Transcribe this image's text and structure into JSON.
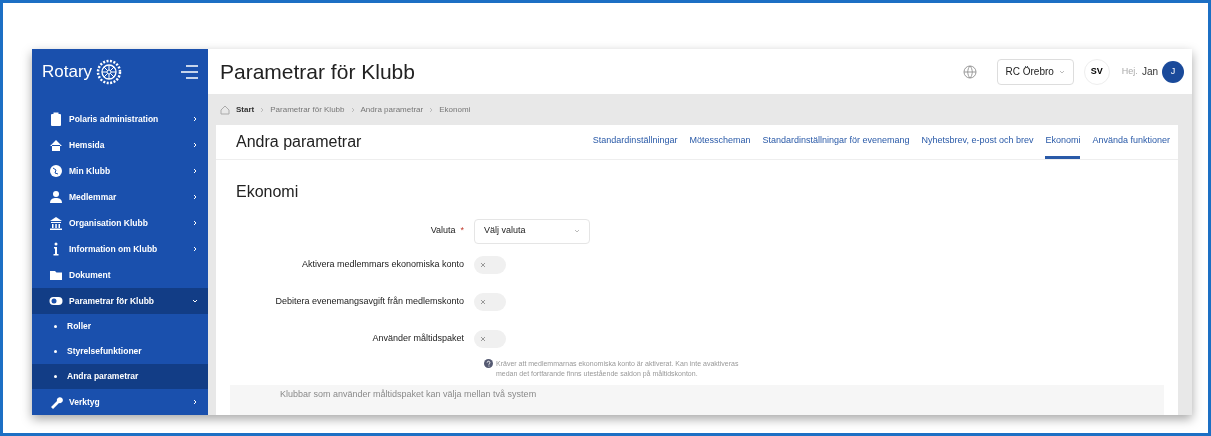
{
  "sidebar": {
    "logo": "Rotary",
    "items": [
      {
        "label": "Polaris administration",
        "selected": false,
        "expanded": false
      },
      {
        "label": "Hemsida",
        "selected": false,
        "expanded": false
      },
      {
        "label": "Min Klubb",
        "selected": false,
        "expanded": false
      },
      {
        "label": "Medlemmar",
        "selected": false,
        "expanded": false
      },
      {
        "label": "Organisation Klubb",
        "selected": false,
        "expanded": false
      },
      {
        "label": "Information om Klubb",
        "selected": false,
        "expanded": false
      },
      {
        "label": "Dokument",
        "selected": false
      },
      {
        "label": "Parametrar för Klubb",
        "selected": true,
        "expanded": true,
        "children": [
          {
            "label": "Roller",
            "selected": false
          },
          {
            "label": "Styrelsefunktioner",
            "selected": false
          },
          {
            "label": "Andra parametrar",
            "selected": true
          }
        ]
      },
      {
        "label": "Verktyg",
        "selected": false,
        "expanded": false
      }
    ]
  },
  "header": {
    "title": "Parametrar för Klubb",
    "club": "RC Örebro",
    "language": "SV",
    "greeting": "Hej.",
    "user": "Jan",
    "avatar": "J"
  },
  "breadcrumb": [
    "Start",
    "Parametrar för Klubb",
    "Andra parametrar",
    "Ekonomi"
  ],
  "card": {
    "title": "Andra parametrar",
    "tabs": [
      {
        "label": "Standardinställningar",
        "selected": false
      },
      {
        "label": "Mötesscheman",
        "selected": false
      },
      {
        "label": "Standardinställningar för evenemang",
        "selected": false
      },
      {
        "label": "Nyhetsbrev, e-post och brev",
        "selected": false
      },
      {
        "label": "Ekonomi",
        "selected": true
      },
      {
        "label": "Använda funktioner",
        "selected": false
      }
    ]
  },
  "section": {
    "title": "Ekonomi",
    "currency": {
      "label": "Valuta",
      "required_mark": "*",
      "placeholder": "Välj valuta"
    },
    "toggles": [
      {
        "label": "Aktivera medlemmars ekonomiska konto",
        "on": false
      },
      {
        "label": "Debitera evenemangsavgift från medlemskonto",
        "on": false
      },
      {
        "label": "Använder måltidspaket",
        "on": false
      }
    ],
    "help": "Kräver att medlemmarnas ekonomiska konto är aktiverat. Kan inte avaktiveras medan det fortfarande finns utestående saldon på måltidskonton.",
    "note": "Klubbar som använder måltidspaket kan välja mellan två system"
  }
}
